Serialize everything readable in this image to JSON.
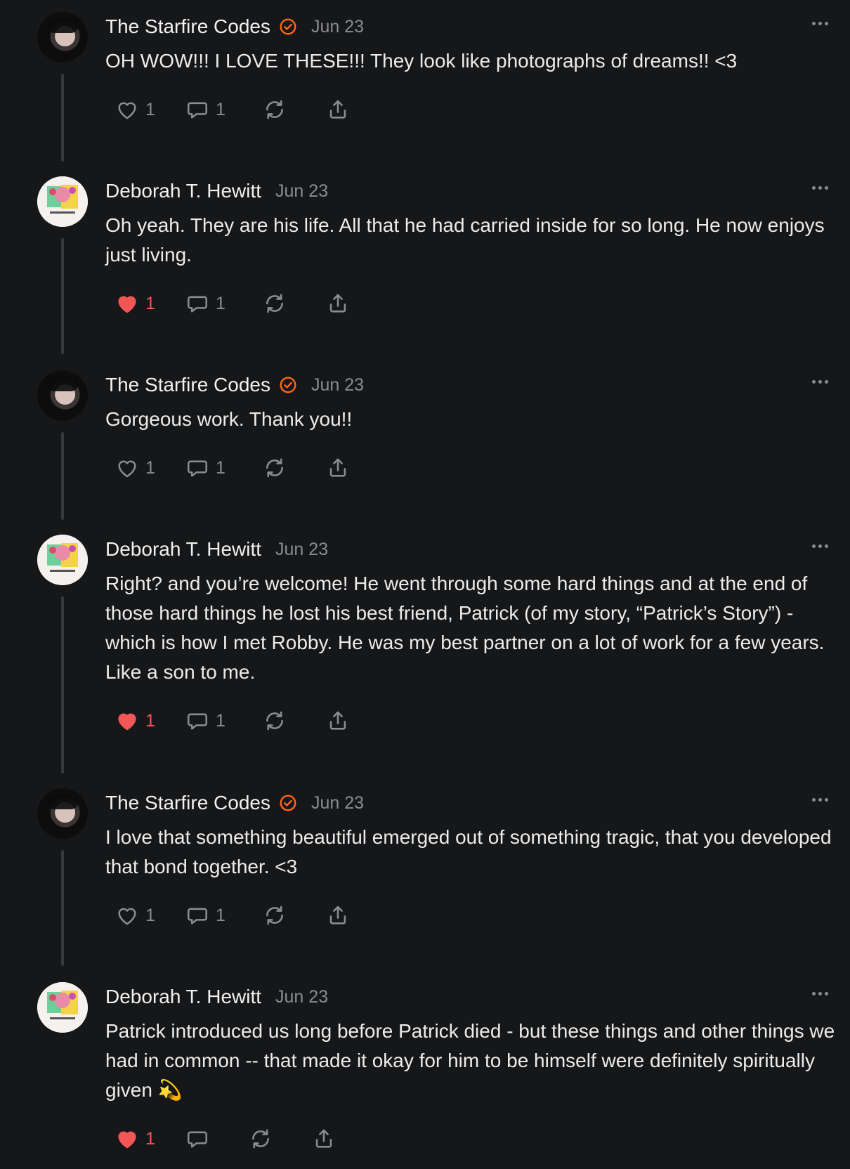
{
  "comments": [
    {
      "author": "The Starfire Codes",
      "verified": true,
      "avatar": "starfire-avatar",
      "date": "Jun 23",
      "text": "OH WOW!!! I LOVE THESE!!! They look like photographs of dreams!! <3",
      "likes": "1",
      "liked": false,
      "replies": "1"
    },
    {
      "author": "Deborah T. Hewitt",
      "verified": false,
      "avatar": "deborah-avatar",
      "date": "Jun 23",
      "text": "Oh yeah. They are his life. All that he had carried inside for so long. He now enjoys just living.",
      "likes": "1",
      "liked": true,
      "replies": "1"
    },
    {
      "author": "The Starfire Codes",
      "verified": true,
      "avatar": "starfire-avatar",
      "date": "Jun 23",
      "text": "Gorgeous work. Thank you!!",
      "likes": "1",
      "liked": false,
      "replies": "1"
    },
    {
      "author": "Deborah T. Hewitt",
      "verified": false,
      "avatar": "deborah-avatar",
      "date": "Jun 23",
      "text": "Right? and you’re welcome! He went through some hard things and at the end of those hard things he lost his best friend, Patrick (of my story, “Patrick’s Story”) - which is how I met Robby. He was my best partner on a lot of work for a few years. Like a son to me.",
      "likes": "1",
      "liked": true,
      "replies": "1"
    },
    {
      "author": "The Starfire Codes",
      "verified": true,
      "avatar": "starfire-avatar",
      "date": "Jun 23",
      "text": "I love that something beautiful emerged out of something tragic, that you developed that bond together. <3",
      "likes": "1",
      "liked": false,
      "replies": "1"
    },
    {
      "author": "Deborah T. Hewitt",
      "verified": false,
      "avatar": "deborah-avatar",
      "date": "Jun 23",
      "text": "Patrick introduced us long before Patrick died - but these things and other things we had in common -- that made it okay for him to be himself were definitely spiritually given 💫",
      "likes": "1",
      "liked": true,
      "replies": ""
    }
  ],
  "colors": {
    "background": "#161719",
    "like_active": "#f25757",
    "verified_badge": "#ff6719",
    "muted": "#8b8c90"
  },
  "icons": [
    "heart-icon",
    "comment-icon",
    "restack-icon",
    "share-icon",
    "more-icon",
    "verified-badge-icon"
  ]
}
